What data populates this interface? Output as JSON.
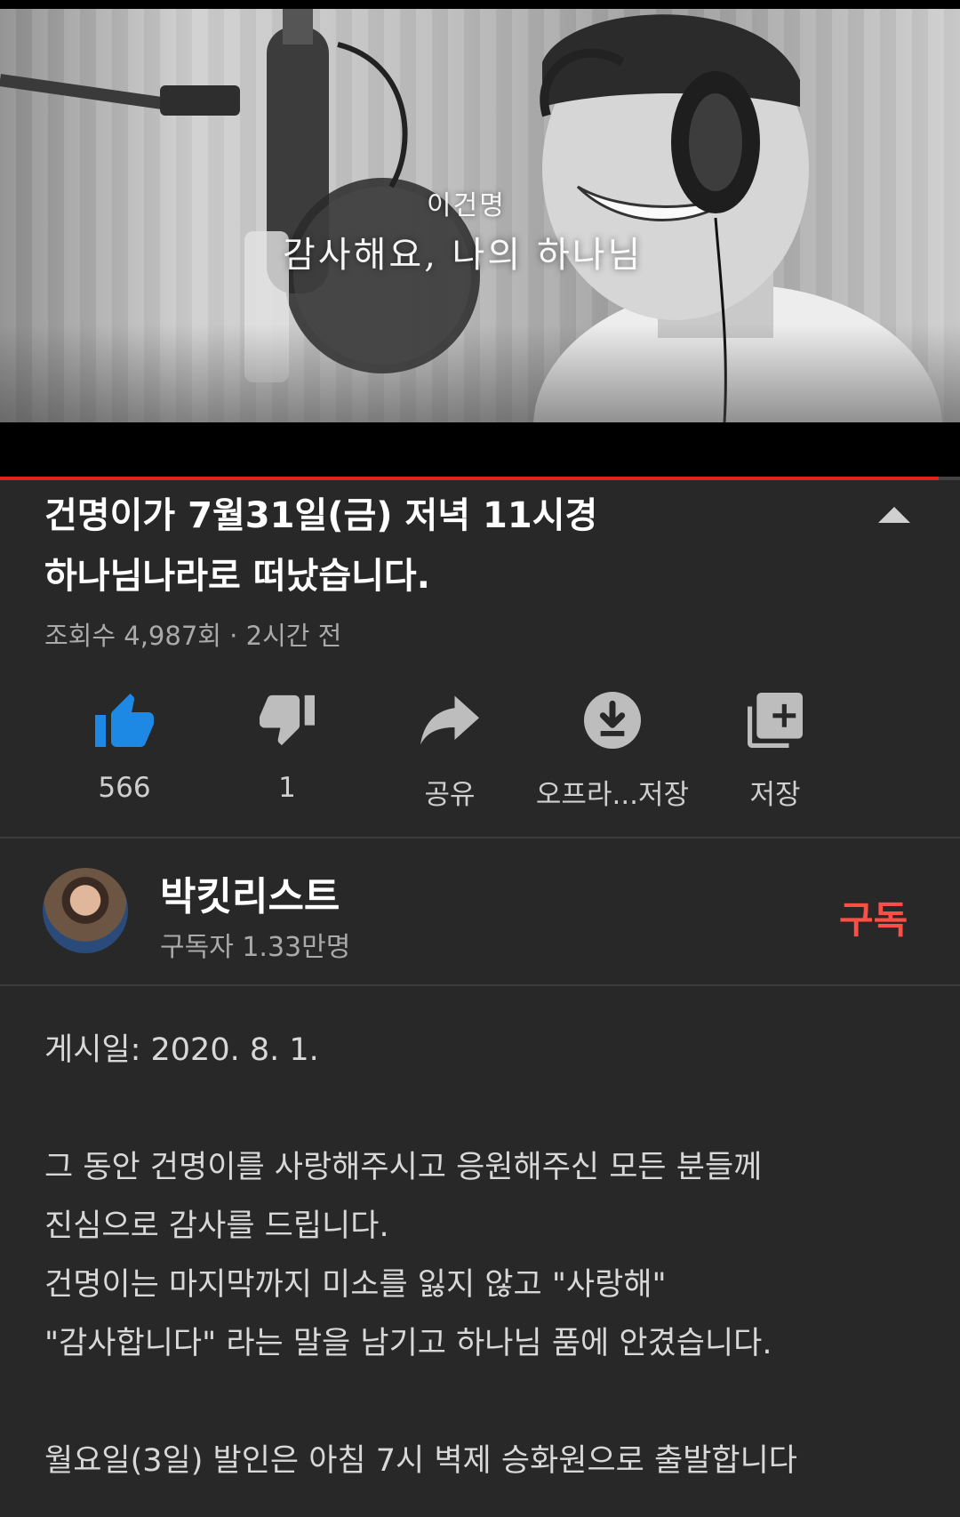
{
  "video": {
    "overlay_name": "이건명",
    "overlay_title": "감사해요, 나의 하나님",
    "progress_percent": 97.8
  },
  "title": {
    "line1": "건명이가 7월31일(금) 저녁 11시경",
    "line2": "하나님나라로 떠났습니다."
  },
  "meta": {
    "views": "조회수 4,987회",
    "separator": " · ",
    "time_ago": "2시간 전"
  },
  "actions": {
    "like_count": "566",
    "dislike_count": "1",
    "share_label": "공유",
    "offline_label": "오프라...저장",
    "save_label": "저장"
  },
  "channel": {
    "name": "박킷리스트",
    "subscribers": "구독자 1.33만명",
    "subscribe_label": "구독"
  },
  "description": {
    "posted": "게시일: 2020. 8. 1.",
    "lines": [
      "그 동안 건명이를 사랑해주시고 응원해주신 모든 분들께",
      "진심으로 감사를 드립니다.",
      "건명이는 마지막까지 미소를 잃지 않고 \"사랑해\"",
      "\"감사합니다\" 라는 말을 남기고 하나님 품에 안겼습니다.",
      "월요일(3일) 발인은 아침 7시 벽제 승화원으로 출발합니다"
    ]
  },
  "colors": {
    "background": "#282828",
    "accent_red": "#ff4e45",
    "like_blue": "#1e88e5",
    "progress_red": "#e62117"
  },
  "icons": [
    "thumbs-up-icon",
    "thumbs-down-icon",
    "share-icon",
    "download-icon",
    "add-to-playlist-icon",
    "collapse-arrow-icon"
  ]
}
